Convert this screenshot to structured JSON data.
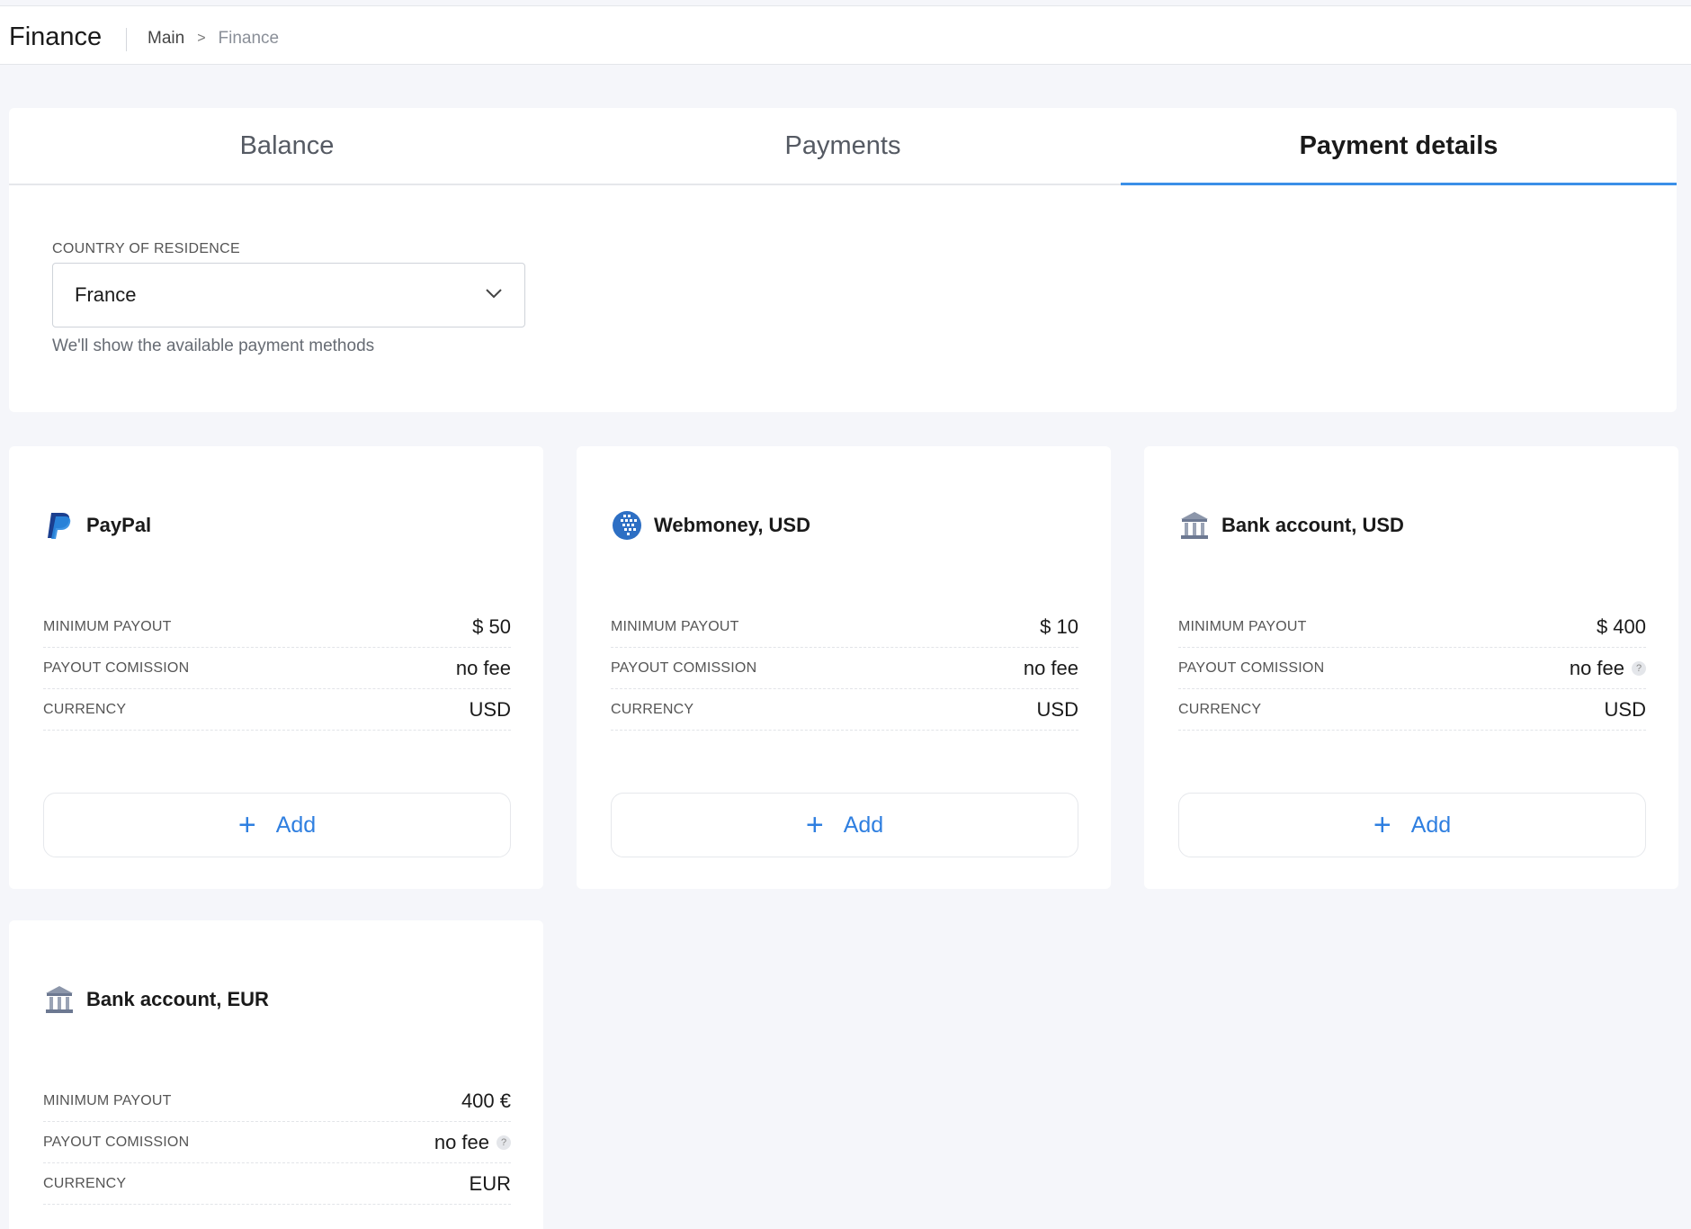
{
  "header": {
    "title": "Finance",
    "breadcrumb": {
      "main": "Main",
      "separator": ">",
      "current": "Finance"
    }
  },
  "tabs": [
    {
      "label": "Balance",
      "active": false
    },
    {
      "label": "Payments",
      "active": false
    },
    {
      "label": "Payment details",
      "active": true
    }
  ],
  "country": {
    "label": "COUNTRY OF RESIDENCE",
    "value": "France",
    "helper": "We'll show the available payment methods"
  },
  "methods": [
    {
      "name": "PayPal",
      "icon": "paypal-icon",
      "rows": [
        {
          "label": "MINIMUM PAYOUT",
          "value": "$ 50"
        },
        {
          "label": "PAYOUT COMISSION",
          "value": "no fee"
        },
        {
          "label": "CURRENCY",
          "value": "USD"
        }
      ],
      "add_label": "Add"
    },
    {
      "name": "Webmoney, USD",
      "icon": "webmoney-icon",
      "rows": [
        {
          "label": "MINIMUM PAYOUT",
          "value": "$ 10"
        },
        {
          "label": "PAYOUT COMISSION",
          "value": "no fee"
        },
        {
          "label": "CURRENCY",
          "value": "USD"
        }
      ],
      "add_label": "Add"
    },
    {
      "name": "Bank account, USD",
      "icon": "bank-icon",
      "rows": [
        {
          "label": "MINIMUM PAYOUT",
          "value": "$ 400"
        },
        {
          "label": "PAYOUT COMISSION",
          "value": "no fee",
          "help": "?"
        },
        {
          "label": "CURRENCY",
          "value": "USD"
        }
      ],
      "add_label": "Add"
    },
    {
      "name": "Bank account, EUR",
      "icon": "bank-icon",
      "rows": [
        {
          "label": "MINIMUM PAYOUT",
          "value": "400 €"
        },
        {
          "label": "PAYOUT COMISSION",
          "value": "no fee",
          "help": "?"
        },
        {
          "label": "CURRENCY",
          "value": "EUR"
        }
      ]
    }
  ],
  "colors": {
    "accent": "#3b8fe8",
    "add_text": "#2f7fe0",
    "background": "#f5f6fa"
  }
}
